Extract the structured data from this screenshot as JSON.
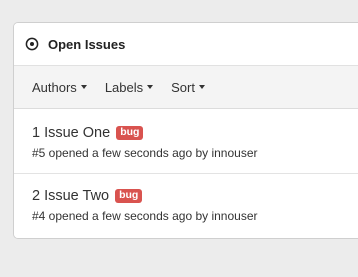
{
  "panel": {
    "title": "Open Issues",
    "icon": "issue-opened-icon"
  },
  "filters": [
    {
      "label": "Authors"
    },
    {
      "label": "Labels"
    },
    {
      "label": "Sort"
    }
  ],
  "issues": [
    {
      "number_title": "1 Issue One",
      "label": "bug",
      "meta": "#5 opened a few seconds ago by innouser"
    },
    {
      "number_title": "2 Issue Two",
      "label": "bug",
      "meta": "#4 opened a few seconds ago by innouser"
    }
  ],
  "colors": {
    "bug_label": "#d9534f",
    "toolbar_bg": "#f4f4f4"
  }
}
